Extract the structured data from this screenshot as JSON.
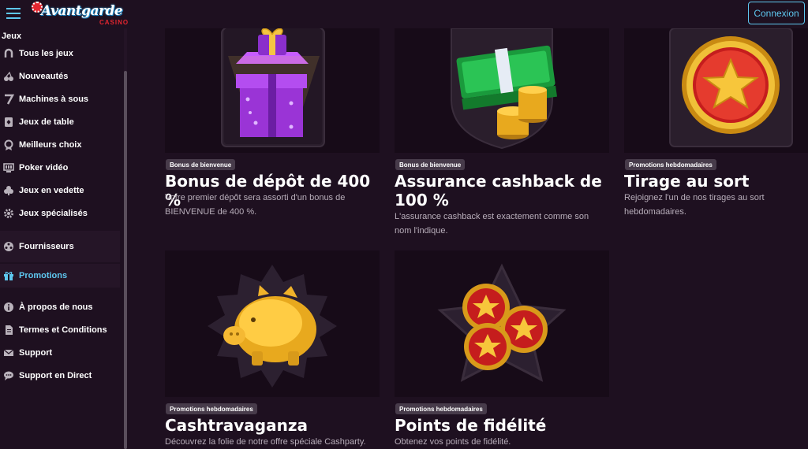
{
  "header": {
    "logo_text": "Avantgarde",
    "logo_sub": "CASINO",
    "login_label": "Connexion"
  },
  "sidebar": {
    "section_label": "Jeux",
    "items": [
      {
        "label": "Tous les jeux",
        "icon": "horseshoe-icon"
      },
      {
        "label": "Nouveautés",
        "icon": "cherries-icon"
      },
      {
        "label": "Machines à sous",
        "icon": "seven-icon"
      },
      {
        "label": "Jeux de table",
        "icon": "cards-icon"
      },
      {
        "label": "Meilleurs choix",
        "icon": "badge-icon"
      },
      {
        "label": "Poker vidéo",
        "icon": "video-poker-icon"
      },
      {
        "label": "Jeux en vedette",
        "icon": "club-icon"
      },
      {
        "label": "Jeux spécialisés",
        "icon": "gear-icon"
      },
      {
        "label": "Fournisseurs",
        "icon": "providers-icon"
      },
      {
        "label": "Promotions",
        "icon": "gift-icon"
      },
      {
        "label": "À propos de nous",
        "icon": "info-icon"
      },
      {
        "label": "Termes et Conditions",
        "icon": "document-icon"
      },
      {
        "label": "Support",
        "icon": "mail-icon"
      },
      {
        "label": "Support en Direct",
        "icon": "chat-icon"
      }
    ]
  },
  "promotions": [
    {
      "badge": "Bonus de bienvenue",
      "title": "Bonus de dépôt de 400 %",
      "description": "Votre premier dépôt sera assorti d'un bonus de BIENVENUE de 400 %."
    },
    {
      "badge": "Bonus de bienvenue",
      "title": "Assurance cashback de 100 %",
      "description": "L'assurance cashback est exactement comme son nom l'indique."
    },
    {
      "badge": "Promotions hebdomadaires",
      "title": "Tirage au sort",
      "description": "Rejoignez l'un de nos tirages au sort hebdomadaires."
    },
    {
      "badge": "Promotions hebdomadaires",
      "title": "Cashtravaganza",
      "description": "Découvrez la folie de notre offre spéciale Cashparty."
    },
    {
      "badge": "Promotions hebdomadaires",
      "title": "Points de fidélité",
      "description": "Obtenez vos points de fidélité."
    }
  ],
  "colors": {
    "background": "#1e1020",
    "accent": "#5ec8f0",
    "card_art_bg": "#170b18",
    "badge_bg": "#473b4a"
  }
}
